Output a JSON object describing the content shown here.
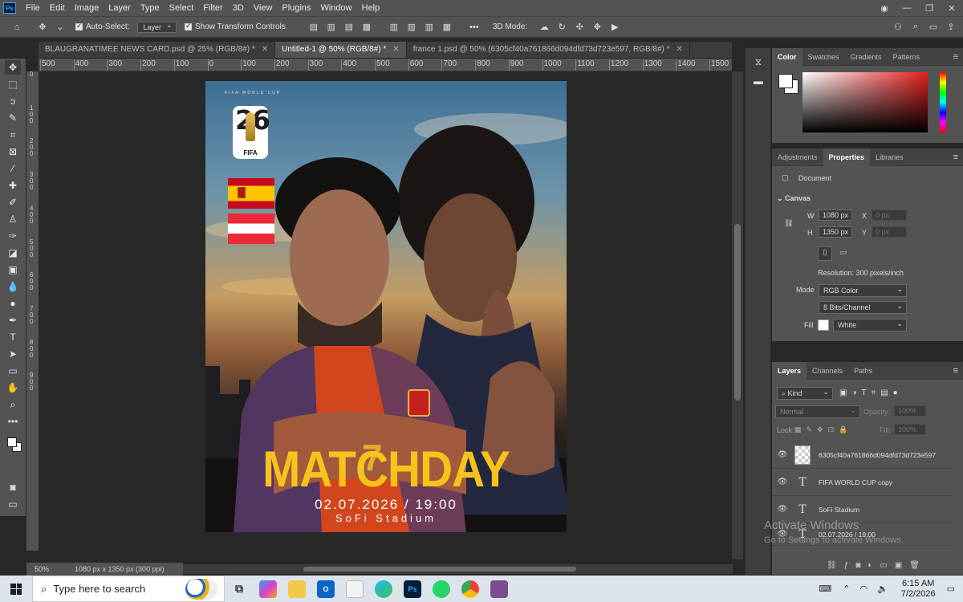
{
  "menubar": {
    "logo": "Ps",
    "items": [
      "File",
      "Edit",
      "Image",
      "Layer",
      "Type",
      "Select",
      "Filter",
      "3D",
      "View",
      "Plugins",
      "Window",
      "Help"
    ]
  },
  "options": {
    "auto_select_label": "Auto-Select:",
    "auto_select_target": "Layer",
    "show_transform_label": "Show Transform Controls",
    "mode_3d_label": "3D Mode:"
  },
  "tabs": [
    {
      "label": "BLAUGRANATIMEE NEWS CARD.psd @ 25% (RGB/8#) *"
    },
    {
      "label": "Untitled-1 @ 50% (RGB/8#) *"
    },
    {
      "label": "france 1.psd @ 50% (6305cf40a761866d094dfd73d723e597, RGB/8#) *"
    }
  ],
  "ruler_top": [
    "500",
    "400",
    "300",
    "200",
    "100",
    "0",
    "100",
    "200",
    "300",
    "400",
    "500",
    "600",
    "700",
    "800",
    "900",
    "1000",
    "1100",
    "1200",
    "1300",
    "1400",
    "1500"
  ],
  "ruler_left": [
    "0",
    "100",
    "200",
    "300",
    "400",
    "500",
    "600",
    "700",
    "800",
    "900"
  ],
  "poster": {
    "overline": "FIFA WORLD CUP",
    "logo_number": "26",
    "logo_text": "FIFA",
    "title": "MATCHDAY",
    "date": "02.07.2026 / 19:00",
    "venue": "SoFi Stadium",
    "jersey_number": "7"
  },
  "status": {
    "zoom": "50%",
    "info": "1080 px x 1350 px (300 ppi)"
  },
  "color_panel": {
    "tabs": [
      "Color",
      "Swatches",
      "Gradients",
      "Patterns"
    ],
    "accent": "#e31f1f"
  },
  "properties": {
    "tabs": [
      "Adjustments",
      "Properties",
      "Libraries"
    ],
    "document_label": "Document",
    "canvas_label": "Canvas",
    "w_label": "W",
    "w_value": "1080 px",
    "h_label": "H",
    "h_value": "1350 px",
    "x_label": "X",
    "x_value": "0 px",
    "y_label": "Y",
    "y_value": "0 px",
    "resolution": "Resolution: 300 pixels/inch",
    "mode_label": "Mode",
    "mode_value": "RGB Color",
    "bits_value": "8 Bits/Channel",
    "fill_label": "Fill",
    "fill_value": "White"
  },
  "layers": {
    "tabs": [
      "Layers",
      "Channels",
      "Paths"
    ],
    "kind": "Kind",
    "blend": "Normal",
    "opacity_label": "Opacity:",
    "opacity_value": "100%",
    "lock_label": "Lock:",
    "fill_label": "Fill:",
    "fill_value": "100%",
    "items": [
      {
        "name": "6305cf40a761866d094dfd73d723e597",
        "type": "pixel"
      },
      {
        "name": "FIFA WORLD CUP copy",
        "type": "text"
      },
      {
        "name": "SoFi Stadium",
        "type": "text"
      },
      {
        "name": "02.07.2026 / 19:00",
        "type": "text"
      }
    ]
  },
  "watermark": {
    "line1": "Activate Windows",
    "line2": "Go to Settings to activate Windows."
  },
  "taskbar": {
    "search_placeholder": "Type here to search",
    "time": "6:15 AM",
    "date": "7/2/2026"
  }
}
